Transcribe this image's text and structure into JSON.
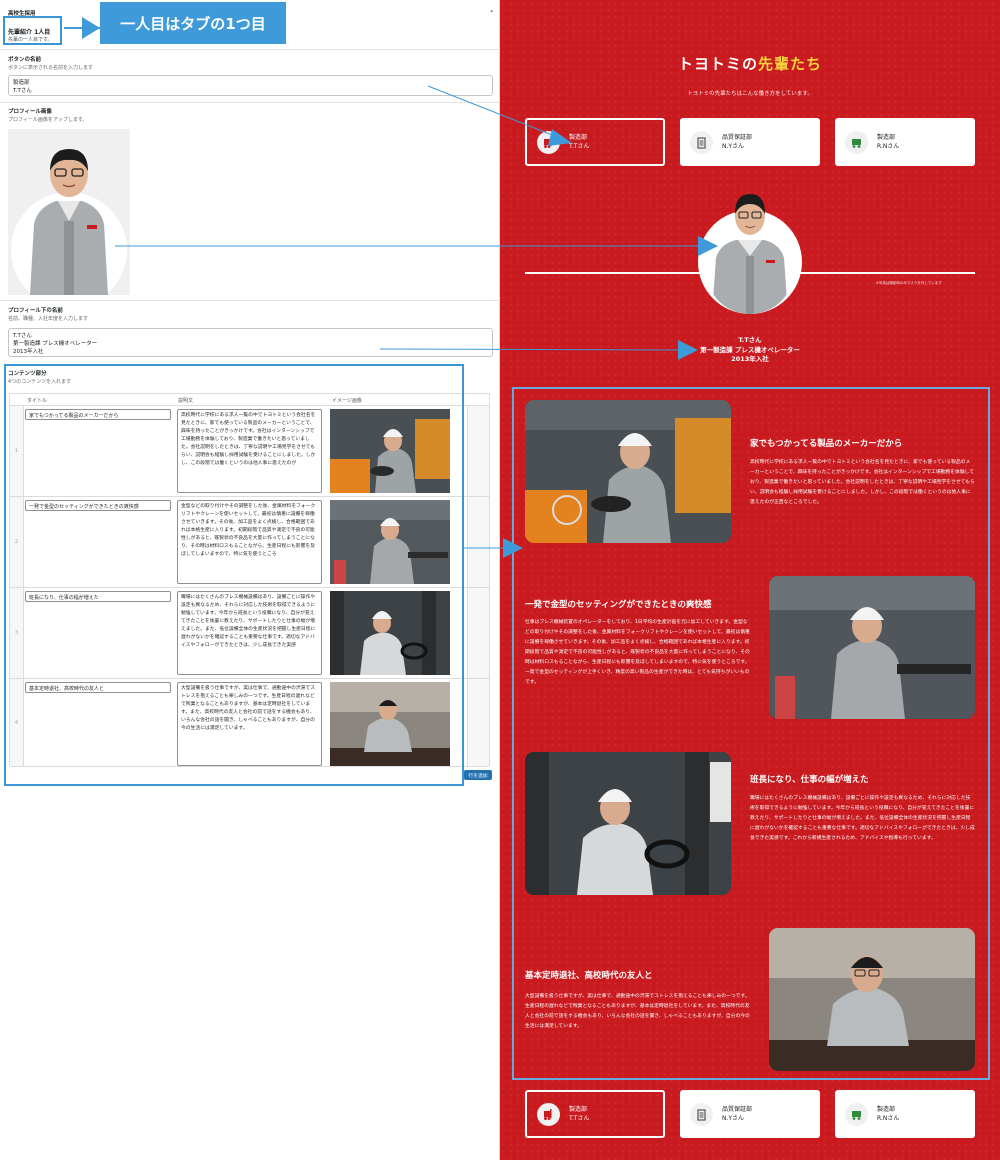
{
  "admin": {
    "panel_title": "高校生採用",
    "group_title": "先輩紹介 1人目",
    "group_sub": "先輩の一人目です。",
    "callout": "一人目はタブの1つ目",
    "button_name": {
      "label": "ボタンの名前",
      "help": "ボタンに表示される名前を入力します",
      "value": "製造部\nT.Tさん"
    },
    "profile_image": {
      "label": "プロフィール画像",
      "help": "プロフィール画像をアップします。"
    },
    "profile_name": {
      "label": "プロフィール下の名前",
      "help": "名前、職種、入社年度を入力します",
      "value": "T.Tさん\n第一製造課 プレス機オペレーター\n2013年入社"
    },
    "contents": {
      "label": "コンテンツ部分",
      "help": "4つのコンテンツを入れます",
      "col_title": "タイトル",
      "col_desc": "説明文",
      "col_image": "イメージ画像",
      "rows": [
        {
          "num": "1",
          "title": "家でもつかってる製品のメーカーだから",
          "desc": "高校時代に学校にある求人一覧の中でトヨトミという会社名を見たときに、家でも使っている製品のメーカーということで、興味を持ったことがきっかけです。会社はインターンシップで工場勤務を体験しており、製造業で働きたいと思っていました。会社説明をしたときは、丁寧な説明や工場見学をさせてもらい、説明会も経験し採用試験を受けることにしました。しかし、この段階では働くというのは他人事に思えたのが"
        },
        {
          "num": "2",
          "title": "一発で金型のセッティングができたときの爽快感",
          "desc": "金型などの取り付けやその調整をした後、金属材料をフォークリフトやクレーンを使いセットして、最初は慎重に設備を稼働させていきます。その後、加工品をよく点検し、合格範囲であれば本格生産に入ります。初期段階で品質や測定で不良の可能性しがあると、既製状の不良品を大量に作ってしまうことになり、その時は材料ロスもることながら、生産日程にも影響を及ぼしてしまいますので、特に気を使うところ"
        },
        {
          "num": "3",
          "title": "班長になり、仕事の幅が増えた",
          "desc": "職場にはたくさんのプレス機械設備はあり、設備ごとに操作や設定も異なるため、それらに対応した技術を取得できるように勉強しています。今年から班長という役職になり、自分が覚えてきたことを後輩に教えたり、サポートしたりと仕事の幅が増えました。また、低位設備全体の生産状況を把握し生産日程に遅れがないかを確認することも重要な仕事です。適切なアドバイスやフォローができたときは、少し成長できた実感"
        },
        {
          "num": "4",
          "title": "基本定時退社、高校時代の友人と",
          "desc": "大型設備を扱う仕事ですが、実は仕事で、通勤途中の渋滞でストレスを抱えることも楽しみの一つです。生産日程の遅れなどで残業となることもありますが、基本は定時退社をしています。また、高校時代の友人と会社の前で話をする機会もあり、いろんな会社の話を聞き、しゃべることもありますが、自分の今の生活には満足しています。"
        }
      ],
      "add_row": "行を追加"
    }
  },
  "site": {
    "title_main": "トヨトミの",
    "title_accent": "先輩たち",
    "subtitle": "トヨトミの先輩たちはこんな働き方をしています。",
    "cards": [
      {
        "dept": "製造部",
        "name": "T.Tさん",
        "icon": "forklift-icon"
      },
      {
        "dept": "品質保証部",
        "name": "N.Yさん",
        "icon": "clipboard-icon"
      },
      {
        "dept": "製造部",
        "name": "R.Nさん",
        "icon": "truck-icon"
      }
    ],
    "photo_caption": "※写真は撮影時のみマスクを外しています",
    "profile_name": "T.Tさん\n第一製造課 プレス機オペレーター\n2013年入社",
    "sections": [
      {
        "title": "家でもつかってる製品のメーカーだから",
        "text": "高校時代に学校にある求人一覧の中でトヨトミという会社名を見たときに、家でも使っている製品のメーカーということで、興味を持ったことがきっかけです。会社はインターンシップで工場勤務を体験しており、製造業で働きたいと思っていました。会社説明をしたときは、丁寧な説明や工場見学をさせてもらい、説明会も経験し採用試験を受けることにしました。しかし、この段階では働くというのは他人事に思えたのが正直なところでした。"
      },
      {
        "title": "一発で金型のセッティングができたときの爽快感",
        "text": "仕事はプレス機械装置のオペレーターをしており、1日平均の生産計画を元に加工していきます。金型などの取り付けやその調整をした後、金属材料をフォークリフトやクレーンを使いセットして、最初は慎重に設備を稼働させていきます。その後、加工品をよく点検し、合格範囲であれば本格生産に入ります。初期段階で品質や測定で不良の可能性しがあると、既製状の不良品を大量に作ってしまうことになり、その時は材料ロスもることながら、生産日程にも影響を及ぼしてしまいますので、特に気を使うところです。一発で金型のセッティングが上手くいき、精度の高い製品の生産ができた時は、とても気持ちがいいものです。"
      },
      {
        "title": "班長になり、仕事の幅が増えた",
        "text": "職場にはたくさんのプレス機械設備はあり、設備ごとに操作や設定も異なるため、それらに対応した技術を取得できるように勉強しています。今年から班長という役職になり、自分が覚えてきたことを後輩に教えたり、サポートしたりと仕事の幅が増えました。また、低位設備全体の生産状況を把握し生産日程に遅れがないかを確認することも重要な仕事です。適切なアドバイスやフォローができたときは、少し成長できた実感です。これから新規生産されるため、アドバイスや指導も行っています。"
      },
      {
        "title": "基本定時退社、高校時代の友人と",
        "text": "大型設備を扱う仕事ですが、実は仕事で、通勤途中の渋滞でストレスを抱えることも楽しみの一つです。生産日程の遅れなどで残業となることもありますが、基本は定時退社をしています。また、高校時代の友人と会社の前で話をする機会もあり、いろんな会社の話を聞き、しゃべることもありますが、自分の今の生活には満足しています。"
      }
    ]
  },
  "colors": {
    "site_red": "#c81a1f",
    "accent_yellow": "#f5d33a",
    "annotation_blue": "#3e9ad8"
  }
}
